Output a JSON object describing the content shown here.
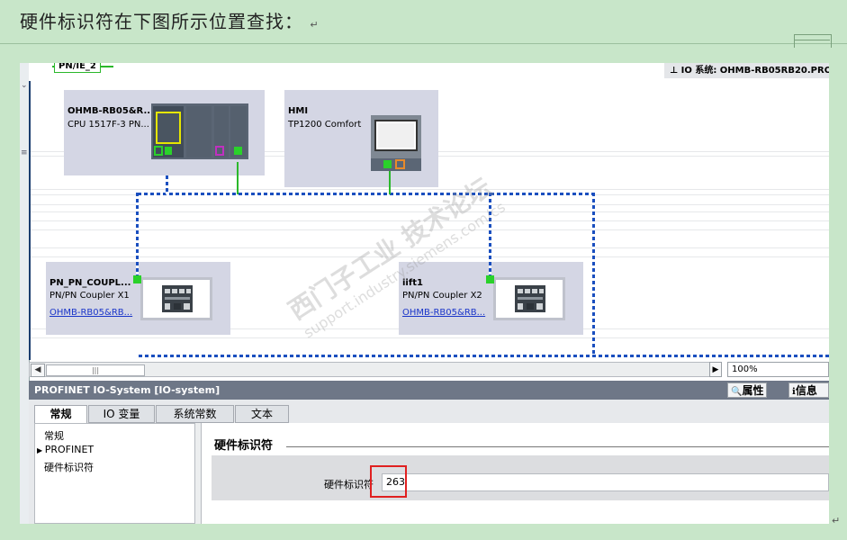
{
  "document": {
    "heading": "硬件标识符在下图所示位置查找：",
    "paragraph_mark": "↵"
  },
  "canvas": {
    "subnet_label": "PN/IE_2",
    "io_system_header": "IO 系统: OHMB-RB05RB20.PRO",
    "pin_icon": "pin-icon",
    "devices": {
      "plc": {
        "name": "OHMB-RB05&R...",
        "subtitle": "CPU 1517F-3 PN..."
      },
      "hmi": {
        "name": "HMI",
        "subtitle": "TP1200 Comfort"
      },
      "coupler1": {
        "name": "PN_PN_COUPL...",
        "subtitle": "PN/PN Coupler X1",
        "link": "OHMB-RB05&RB..."
      },
      "coupler2": {
        "name": "iift1",
        "subtitle": "PN/PN Coupler X2",
        "link": "OHMB-RB05&RB..."
      }
    },
    "scroll_thumb_label": "|||",
    "zoom": "100%",
    "watermark_line1": "西门子工业 技术论坛",
    "watermark_line2": "support.industry.siemens.com/cs"
  },
  "inspector": {
    "title": "PROFINET IO-System [IO-system]",
    "properties_label": "属性",
    "info_label": "信息",
    "tabs": [
      "常规",
      "IO 变量",
      "系统常数",
      "文本"
    ],
    "active_tab": "常规",
    "nav": {
      "general": "常规",
      "profinet": "PROFINET",
      "hardware_id": "硬件标识符"
    },
    "section_title": "硬件标识符",
    "field_label": "硬件标识符",
    "field_value": "263"
  },
  "colors": {
    "page_background": "#c8e6c9",
    "profinet_dashed": "#1a4fbf",
    "port_green": "#2ad12a",
    "highlight_red": "#e02020",
    "inspector_bar": "#6e7787"
  }
}
